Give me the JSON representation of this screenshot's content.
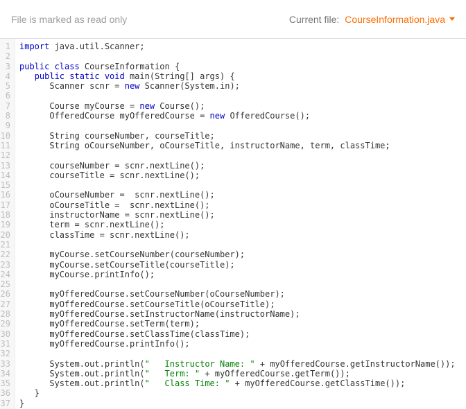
{
  "header": {
    "readonly_msg": "File is marked as read only",
    "current_file_label": "Current file:",
    "current_file_name": "CourseInformation.java"
  },
  "colors": {
    "accent": "#ff6d00",
    "keyword": "#0000c8",
    "string": "#008000",
    "gutter_bg": "#f7f7f7",
    "gutter_fg": "#bdbdbd"
  },
  "code": {
    "lines": [
      [
        {
          "t": "import",
          "c": "kw"
        },
        {
          "t": " java.util.Scanner;",
          "c": "plain"
        }
      ],
      [],
      [
        {
          "t": "public class",
          "c": "kw"
        },
        {
          "t": " CourseInformation {",
          "c": "plain"
        }
      ],
      [
        {
          "t": "   ",
          "c": "plain"
        },
        {
          "t": "public static void",
          "c": "kw"
        },
        {
          "t": " main(String[] args) {",
          "c": "plain"
        }
      ],
      [
        {
          "t": "      Scanner scnr = ",
          "c": "plain"
        },
        {
          "t": "new",
          "c": "kw"
        },
        {
          "t": " Scanner(System.in);",
          "c": "plain"
        }
      ],
      [],
      [
        {
          "t": "      Course myCourse = ",
          "c": "plain"
        },
        {
          "t": "new",
          "c": "kw"
        },
        {
          "t": " Course();",
          "c": "plain"
        }
      ],
      [
        {
          "t": "      OfferedCourse myOfferedCourse = ",
          "c": "plain"
        },
        {
          "t": "new",
          "c": "kw"
        },
        {
          "t": " OfferedCourse();",
          "c": "plain"
        }
      ],
      [],
      [
        {
          "t": "      String courseNumber, courseTitle;",
          "c": "plain"
        }
      ],
      [
        {
          "t": "      String oCourseNumber, oCourseTitle, instructorName, term, classTime;",
          "c": "plain"
        }
      ],
      [],
      [
        {
          "t": "      courseNumber = scnr.nextLine();",
          "c": "plain"
        }
      ],
      [
        {
          "t": "      courseTitle = scnr.nextLine();",
          "c": "plain"
        }
      ],
      [],
      [
        {
          "t": "      oCourseNumber =  scnr.nextLine();",
          "c": "plain"
        }
      ],
      [
        {
          "t": "      oCourseTitle =  scnr.nextLine();",
          "c": "plain"
        }
      ],
      [
        {
          "t": "      instructorName = scnr.nextLine();",
          "c": "plain"
        }
      ],
      [
        {
          "t": "      term = scnr.nextLine();",
          "c": "plain"
        }
      ],
      [
        {
          "t": "      classTime = scnr.nextLine();",
          "c": "plain"
        }
      ],
      [],
      [
        {
          "t": "      myCourse.setCourseNumber(courseNumber);",
          "c": "plain"
        }
      ],
      [
        {
          "t": "      myCourse.setCourseTitle(courseTitle);",
          "c": "plain"
        }
      ],
      [
        {
          "t": "      myCourse.printInfo();",
          "c": "plain"
        }
      ],
      [],
      [
        {
          "t": "      myOfferedCourse.setCourseNumber(oCourseNumber);",
          "c": "plain"
        }
      ],
      [
        {
          "t": "      myOfferedCourse.setCourseTitle(oCourseTitle);",
          "c": "plain"
        }
      ],
      [
        {
          "t": "      myOfferedCourse.setInstructorName(instructorName);",
          "c": "plain"
        }
      ],
      [
        {
          "t": "      myOfferedCourse.setTerm(term);",
          "c": "plain"
        }
      ],
      [
        {
          "t": "      myOfferedCourse.setClassTime(classTime);",
          "c": "plain"
        }
      ],
      [
        {
          "t": "      myOfferedCourse.printInfo();",
          "c": "plain"
        }
      ],
      [],
      [
        {
          "t": "      System.out.println(",
          "c": "plain"
        },
        {
          "t": "\"   Instructor Name: \"",
          "c": "str"
        },
        {
          "t": " + myOfferedCourse.getInstructorName());",
          "c": "plain"
        }
      ],
      [
        {
          "t": "      System.out.println(",
          "c": "plain"
        },
        {
          "t": "\"   Term: \"",
          "c": "str"
        },
        {
          "t": " + myOfferedCourse.getTerm());",
          "c": "plain"
        }
      ],
      [
        {
          "t": "      System.out.println(",
          "c": "plain"
        },
        {
          "t": "\"   Class Time: \"",
          "c": "str"
        },
        {
          "t": " + myOfferedCourse.getClassTime());",
          "c": "plain"
        }
      ],
      [
        {
          "t": "   }",
          "c": "plain"
        }
      ],
      [
        {
          "t": "}",
          "c": "plain"
        }
      ]
    ]
  }
}
